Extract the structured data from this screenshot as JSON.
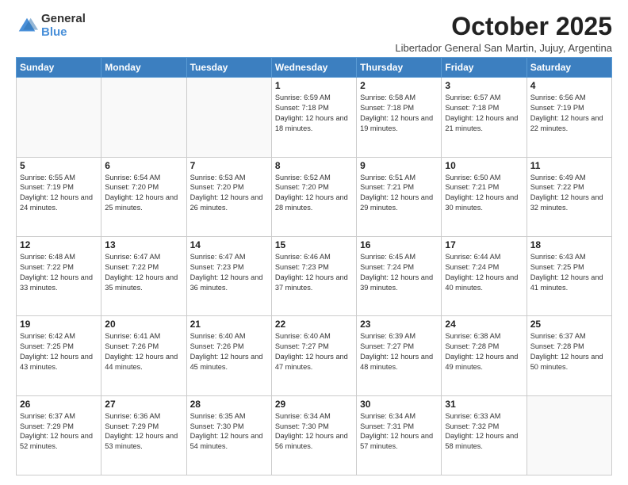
{
  "logo": {
    "general": "General",
    "blue": "Blue"
  },
  "title": "October 2025",
  "subtitle": "Libertador General San Martin, Jujuy, Argentina",
  "days_of_week": [
    "Sunday",
    "Monday",
    "Tuesday",
    "Wednesday",
    "Thursday",
    "Friday",
    "Saturday"
  ],
  "weeks": [
    [
      {
        "day": "",
        "info": ""
      },
      {
        "day": "",
        "info": ""
      },
      {
        "day": "",
        "info": ""
      },
      {
        "day": "1",
        "info": "Sunrise: 6:59 AM\nSunset: 7:18 PM\nDaylight: 12 hours and 18 minutes."
      },
      {
        "day": "2",
        "info": "Sunrise: 6:58 AM\nSunset: 7:18 PM\nDaylight: 12 hours and 19 minutes."
      },
      {
        "day": "3",
        "info": "Sunrise: 6:57 AM\nSunset: 7:18 PM\nDaylight: 12 hours and 21 minutes."
      },
      {
        "day": "4",
        "info": "Sunrise: 6:56 AM\nSunset: 7:19 PM\nDaylight: 12 hours and 22 minutes."
      }
    ],
    [
      {
        "day": "5",
        "info": "Sunrise: 6:55 AM\nSunset: 7:19 PM\nDaylight: 12 hours and 24 minutes."
      },
      {
        "day": "6",
        "info": "Sunrise: 6:54 AM\nSunset: 7:20 PM\nDaylight: 12 hours and 25 minutes."
      },
      {
        "day": "7",
        "info": "Sunrise: 6:53 AM\nSunset: 7:20 PM\nDaylight: 12 hours and 26 minutes."
      },
      {
        "day": "8",
        "info": "Sunrise: 6:52 AM\nSunset: 7:20 PM\nDaylight: 12 hours and 28 minutes."
      },
      {
        "day": "9",
        "info": "Sunrise: 6:51 AM\nSunset: 7:21 PM\nDaylight: 12 hours and 29 minutes."
      },
      {
        "day": "10",
        "info": "Sunrise: 6:50 AM\nSunset: 7:21 PM\nDaylight: 12 hours and 30 minutes."
      },
      {
        "day": "11",
        "info": "Sunrise: 6:49 AM\nSunset: 7:22 PM\nDaylight: 12 hours and 32 minutes."
      }
    ],
    [
      {
        "day": "12",
        "info": "Sunrise: 6:48 AM\nSunset: 7:22 PM\nDaylight: 12 hours and 33 minutes."
      },
      {
        "day": "13",
        "info": "Sunrise: 6:47 AM\nSunset: 7:22 PM\nDaylight: 12 hours and 35 minutes."
      },
      {
        "day": "14",
        "info": "Sunrise: 6:47 AM\nSunset: 7:23 PM\nDaylight: 12 hours and 36 minutes."
      },
      {
        "day": "15",
        "info": "Sunrise: 6:46 AM\nSunset: 7:23 PM\nDaylight: 12 hours and 37 minutes."
      },
      {
        "day": "16",
        "info": "Sunrise: 6:45 AM\nSunset: 7:24 PM\nDaylight: 12 hours and 39 minutes."
      },
      {
        "day": "17",
        "info": "Sunrise: 6:44 AM\nSunset: 7:24 PM\nDaylight: 12 hours and 40 minutes."
      },
      {
        "day": "18",
        "info": "Sunrise: 6:43 AM\nSunset: 7:25 PM\nDaylight: 12 hours and 41 minutes."
      }
    ],
    [
      {
        "day": "19",
        "info": "Sunrise: 6:42 AM\nSunset: 7:25 PM\nDaylight: 12 hours and 43 minutes."
      },
      {
        "day": "20",
        "info": "Sunrise: 6:41 AM\nSunset: 7:26 PM\nDaylight: 12 hours and 44 minutes."
      },
      {
        "day": "21",
        "info": "Sunrise: 6:40 AM\nSunset: 7:26 PM\nDaylight: 12 hours and 45 minutes."
      },
      {
        "day": "22",
        "info": "Sunrise: 6:40 AM\nSunset: 7:27 PM\nDaylight: 12 hours and 47 minutes."
      },
      {
        "day": "23",
        "info": "Sunrise: 6:39 AM\nSunset: 7:27 PM\nDaylight: 12 hours and 48 minutes."
      },
      {
        "day": "24",
        "info": "Sunrise: 6:38 AM\nSunset: 7:28 PM\nDaylight: 12 hours and 49 minutes."
      },
      {
        "day": "25",
        "info": "Sunrise: 6:37 AM\nSunset: 7:28 PM\nDaylight: 12 hours and 50 minutes."
      }
    ],
    [
      {
        "day": "26",
        "info": "Sunrise: 6:37 AM\nSunset: 7:29 PM\nDaylight: 12 hours and 52 minutes."
      },
      {
        "day": "27",
        "info": "Sunrise: 6:36 AM\nSunset: 7:29 PM\nDaylight: 12 hours and 53 minutes."
      },
      {
        "day": "28",
        "info": "Sunrise: 6:35 AM\nSunset: 7:30 PM\nDaylight: 12 hours and 54 minutes."
      },
      {
        "day": "29",
        "info": "Sunrise: 6:34 AM\nSunset: 7:30 PM\nDaylight: 12 hours and 56 minutes."
      },
      {
        "day": "30",
        "info": "Sunrise: 6:34 AM\nSunset: 7:31 PM\nDaylight: 12 hours and 57 minutes."
      },
      {
        "day": "31",
        "info": "Sunrise: 6:33 AM\nSunset: 7:32 PM\nDaylight: 12 hours and 58 minutes."
      },
      {
        "day": "",
        "info": ""
      }
    ]
  ]
}
